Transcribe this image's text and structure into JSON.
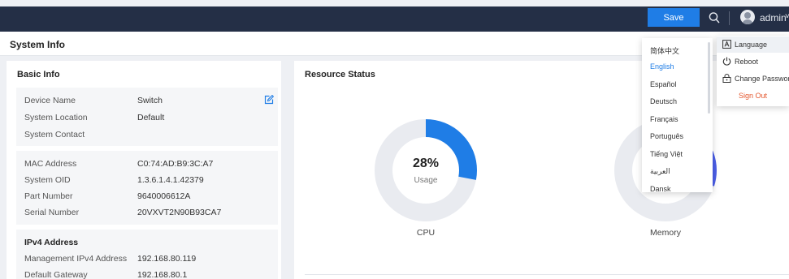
{
  "topbar": {
    "save_label": "Save",
    "user_name": "admin",
    "caret": "˅",
    "icons": [
      "search-icon",
      "user-avatar-icon",
      "chevron-down-icon"
    ]
  },
  "page": {
    "title": "System Info"
  },
  "basic_info": {
    "title": "Basic Info",
    "groups": [
      {
        "rows": [
          {
            "label": "Device Name",
            "value": "Switch"
          },
          {
            "label": "System Location",
            "value": "Default"
          },
          {
            "label": "System Contact",
            "value": ""
          }
        ]
      },
      {
        "rows": [
          {
            "label": "MAC Address",
            "value": "C0:74:AD:B9:3C:A7"
          },
          {
            "label": "System OID",
            "value": "1.3.6.1.4.1.42379"
          },
          {
            "label": "Part Number",
            "value": "9640006612A"
          },
          {
            "label": "Serial Number",
            "value": "20VXVT2N90B93CA7"
          }
        ]
      },
      {
        "title": "IPv4 Address",
        "rows": [
          {
            "label": "Management IPv4 Address",
            "value": "192.168.80.119"
          },
          {
            "label": "Default Gateway",
            "value": "192.168.80.1"
          }
        ]
      }
    ]
  },
  "resource_status": {
    "title": "Resource Status",
    "cpu": {
      "percent_text": "28%",
      "sub_label": "Usage",
      "label": "CPU",
      "usage_fraction": 0.28
    },
    "memory": {
      "label": "Memory",
      "usage_fraction": 0.3
    }
  },
  "language_menu": {
    "items": [
      "简体中文",
      "English",
      "Español",
      "Deutsch",
      "Français",
      "Português",
      "Tiếng Việt",
      "العربية",
      "Dansk"
    ],
    "active": "English"
  },
  "user_menu": {
    "items": [
      {
        "label": "Language",
        "icon": "language-icon"
      },
      {
        "label": "Reboot",
        "icon": "power-icon"
      },
      {
        "label": "Change Password",
        "icon": "lock-icon"
      }
    ],
    "sign_out": "Sign Out"
  },
  "colors": {
    "topbar": "#242f46",
    "accent": "#1f7de6",
    "donut_track": "#e9ebf0",
    "memory_fill": "#4b5ee8",
    "sign_out": "#e4572e"
  }
}
